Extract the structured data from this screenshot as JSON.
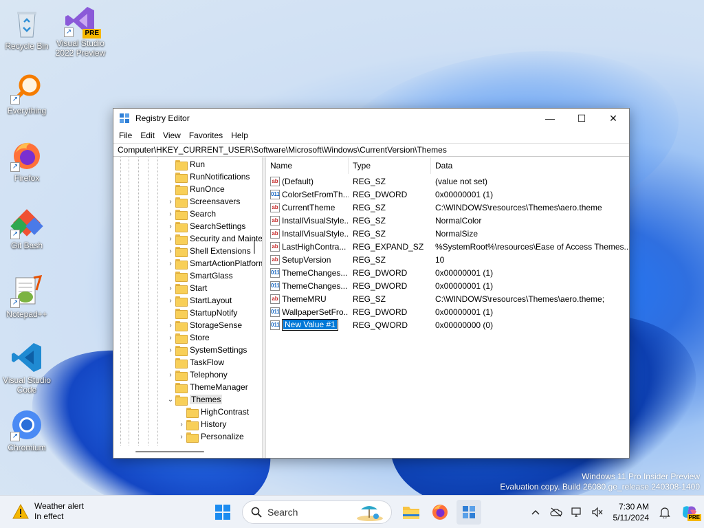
{
  "desktop": {
    "icons": [
      {
        "label": "Recycle Bin"
      },
      {
        "label": "Visual Studio 2022 Preview",
        "badge": "PRE"
      },
      {
        "label": "Everything"
      },
      {
        "label": "Firefox"
      },
      {
        "label": "Git Bash"
      },
      {
        "label": "Notepad++"
      },
      {
        "label": "Visual Studio Code"
      },
      {
        "label": "Chromium"
      }
    ],
    "watermark": {
      "line1": "Windows 11 Pro Insider Preview",
      "line2": "Evaluation copy. Build 26080.ge_release.240308-1400"
    }
  },
  "window": {
    "title": "Registry Editor",
    "controls": {
      "minimize": "—",
      "maximize": "☐",
      "close": "✕"
    },
    "menu": [
      "File",
      "Edit",
      "View",
      "Favorites",
      "Help"
    ],
    "address": "Computer\\HKEY_CURRENT_USER\\Software\\Microsoft\\Windows\\CurrentVersion\\Themes",
    "tree": [
      {
        "label": "Run",
        "expander": false,
        "level": 0
      },
      {
        "label": "RunNotifications",
        "expander": false,
        "level": 0
      },
      {
        "label": "RunOnce",
        "expander": false,
        "level": 0
      },
      {
        "label": "Screensavers",
        "expander": true,
        "level": 0
      },
      {
        "label": "Search",
        "expander": true,
        "level": 0
      },
      {
        "label": "SearchSettings",
        "expander": true,
        "level": 0
      },
      {
        "label": "Security and Maintenance",
        "expander": true,
        "level": 0
      },
      {
        "label": "Shell Extensions",
        "expander": true,
        "level": 0
      },
      {
        "label": "SmartActionPlatform",
        "expander": true,
        "level": 0
      },
      {
        "label": "SmartGlass",
        "expander": false,
        "level": 0
      },
      {
        "label": "Start",
        "expander": true,
        "level": 0
      },
      {
        "label": "StartLayout",
        "expander": true,
        "level": 0
      },
      {
        "label": "StartupNotify",
        "expander": false,
        "level": 0
      },
      {
        "label": "StorageSense",
        "expander": true,
        "level": 0
      },
      {
        "label": "Store",
        "expander": true,
        "level": 0
      },
      {
        "label": "SystemSettings",
        "expander": true,
        "level": 0
      },
      {
        "label": "TaskFlow",
        "expander": false,
        "level": 0
      },
      {
        "label": "Telephony",
        "expander": true,
        "level": 0
      },
      {
        "label": "ThemeManager",
        "expander": false,
        "level": 0
      },
      {
        "label": "Themes",
        "expander": "open",
        "level": 0,
        "selected": true
      },
      {
        "label": "HighContrast",
        "expander": false,
        "level": 1
      },
      {
        "label": "History",
        "expander": true,
        "level": 1
      },
      {
        "label": "Personalize",
        "expander": true,
        "level": 1
      }
    ],
    "columns": [
      "Name",
      "Type",
      "Data"
    ],
    "values": [
      {
        "icon": "ab",
        "name": "(Default)",
        "type": "REG_SZ",
        "data": "(value not set)"
      },
      {
        "icon": "bin",
        "name": "ColorSetFromTh...",
        "type": "REG_DWORD",
        "data": "0x00000001 (1)"
      },
      {
        "icon": "ab",
        "name": "CurrentTheme",
        "type": "REG_SZ",
        "data": "C:\\WINDOWS\\resources\\Themes\\aero.theme"
      },
      {
        "icon": "ab",
        "name": "InstallVisualStyle...",
        "type": "REG_SZ",
        "data": "NormalColor"
      },
      {
        "icon": "ab",
        "name": "InstallVisualStyle...",
        "type": "REG_SZ",
        "data": "NormalSize"
      },
      {
        "icon": "ab",
        "name": "LastHighContra...",
        "type": "REG_EXPAND_SZ",
        "data": "%SystemRoot%\\resources\\Ease of Access Themes..."
      },
      {
        "icon": "ab",
        "name": "SetupVersion",
        "type": "REG_SZ",
        "data": "10"
      },
      {
        "icon": "bin",
        "name": "ThemeChanges...",
        "type": "REG_DWORD",
        "data": "0x00000001 (1)"
      },
      {
        "icon": "bin",
        "name": "ThemeChanges...",
        "type": "REG_DWORD",
        "data": "0x00000001 (1)"
      },
      {
        "icon": "ab",
        "name": "ThemeMRU",
        "type": "REG_SZ",
        "data": "C:\\WINDOWS\\resources\\Themes\\aero.theme;"
      },
      {
        "icon": "bin",
        "name": "WallpaperSetFro...",
        "type": "REG_DWORD",
        "data": "0x00000001 (1)"
      },
      {
        "icon": "bin",
        "name": "New Value #1",
        "type": "REG_QWORD",
        "data": "0x00000000 (0)",
        "editing": true
      }
    ]
  },
  "taskbar": {
    "weather": {
      "title": "Weather alert",
      "subtitle": "In effect"
    },
    "search_placeholder": "Search",
    "clock": {
      "time": "7:30 AM",
      "date": "5/11/2024"
    },
    "copilot_badge": "PRE",
    "accent": "#0078d7"
  }
}
